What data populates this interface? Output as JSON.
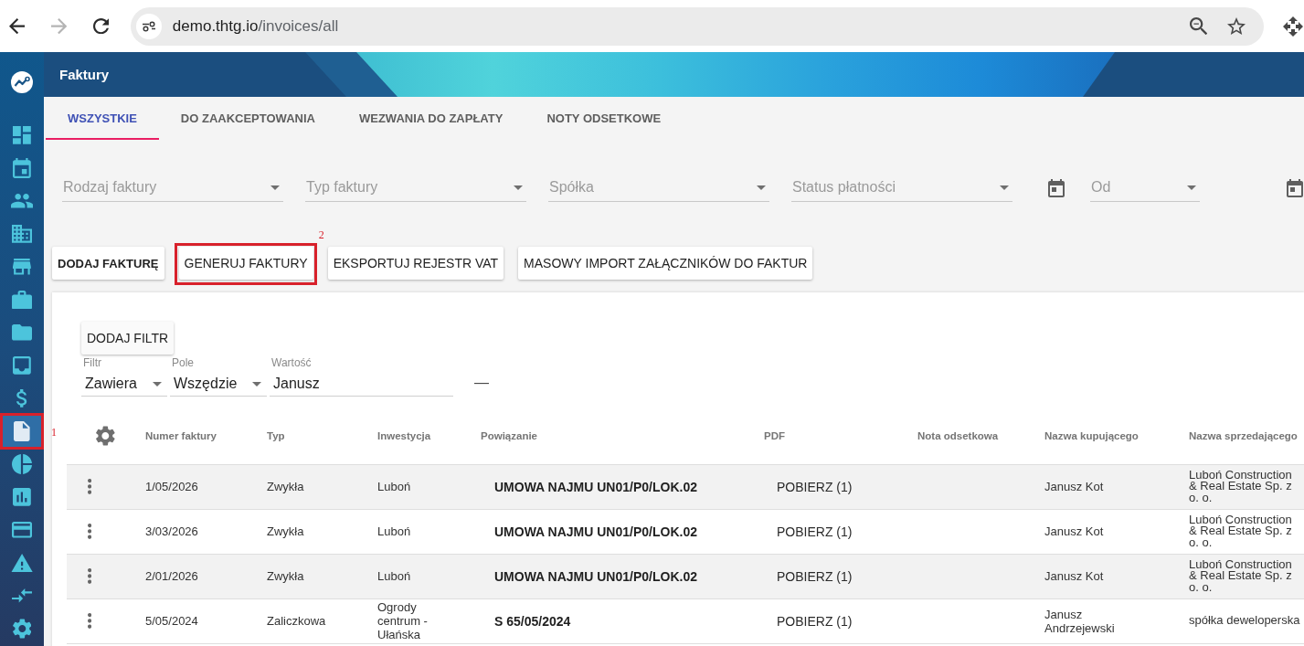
{
  "browser": {
    "url_host": "demo.thtg.io",
    "url_path": "/invoices/all",
    "forward_disabled": true
  },
  "sidebar": {
    "items": [
      {
        "kind": "dashboard",
        "selected": false
      },
      {
        "kind": "calendar",
        "selected": false
      },
      {
        "kind": "people",
        "selected": false
      },
      {
        "kind": "building",
        "selected": false
      },
      {
        "kind": "store",
        "selected": false
      },
      {
        "kind": "briefcase",
        "selected": false
      },
      {
        "kind": "folder",
        "selected": false
      },
      {
        "kind": "inbox",
        "selected": false
      },
      {
        "kind": "dollar",
        "selected": false
      },
      {
        "kind": "document",
        "selected": true,
        "annotation": "1"
      },
      {
        "kind": "pie-chart",
        "selected": false
      },
      {
        "kind": "bar-chart",
        "selected": false
      },
      {
        "kind": "credit-card",
        "selected": false
      },
      {
        "kind": "warning",
        "selected": false
      },
      {
        "kind": "arrows",
        "selected": false
      },
      {
        "kind": "settings",
        "selected": false
      }
    ]
  },
  "header": {
    "title": "Faktury"
  },
  "tabs": [
    {
      "label": "WSZYSTKIE",
      "selected": true
    },
    {
      "label": "DO ZAAKCEPTOWANIA",
      "selected": false
    },
    {
      "label": "WEZWANIA DO ZAPŁATY",
      "selected": false
    },
    {
      "label": "NOTY ODSETKOWE",
      "selected": false
    }
  ],
  "filters": [
    {
      "kind": "select",
      "placeholder": "Rodzaj faktury"
    },
    {
      "kind": "select",
      "placeholder": "Typ faktury"
    },
    {
      "kind": "select",
      "placeholder": "Spółka"
    },
    {
      "kind": "select",
      "placeholder": "Status płatności"
    },
    {
      "kind": "date",
      "placeholder": "Od"
    },
    {
      "kind": "date"
    }
  ],
  "actions": [
    {
      "label": "DODAJ FAKTURĘ",
      "emphasized": true
    },
    {
      "label": "GENERUJ FAKTURY",
      "emphasized": false,
      "annotation": "2"
    },
    {
      "label": "EKSPORTUJ REJESTR VAT",
      "emphasized": false
    },
    {
      "label": "MASOWY IMPORT ZAŁĄCZNIKÓW DO FAKTUR",
      "emphasized": false
    }
  ],
  "filter_panel": {
    "add_button": "DODAJ FILTR",
    "rules": [
      {
        "operator": {
          "label": "Filtr",
          "value": "Zawiera"
        },
        "field": {
          "label": "Pole",
          "value": "Wszędzie"
        },
        "value": {
          "label": "Wartość",
          "value": "Janusz"
        },
        "remove": "—"
      }
    ]
  },
  "table": {
    "columns": [
      "Numer faktury",
      "Typ",
      "Inwestycja",
      "Powiązanie",
      "PDF",
      "Nota odsetkowa",
      "Nazwa kupującego",
      "Nazwa sprzedającego"
    ],
    "rows": [
      {
        "number": "1/05/2026",
        "type": "Zwykła",
        "investment": "Luboń",
        "relation": "UMOWA NAJMU UN01/P0/LOK.02",
        "pdf": "POBIERZ (1)",
        "buyer": "Janusz Kot",
        "seller": "Luboń Construction & Real Estate Sp. z o. o."
      },
      {
        "number": "3/03/2026",
        "type": "Zwykła",
        "investment": "Luboń",
        "relation": "UMOWA NAJMU UN01/P0/LOK.02",
        "pdf": "POBIERZ (1)",
        "buyer": "Janusz Kot",
        "seller": "Luboń Construction & Real Estate Sp. z o. o."
      },
      {
        "number": "2/01/2026",
        "type": "Zwykła",
        "investment": "Luboń",
        "relation": "UMOWA NAJMU UN01/P0/LOK.02",
        "pdf": "POBIERZ (1)",
        "buyer": "Janusz Kot",
        "seller": "Luboń Construction & Real Estate Sp. z o. o."
      },
      {
        "number": "5/05/2024",
        "type": "Zaliczkowa",
        "investment": "Ogrody centrum - Ułańska",
        "relation": "S 65/05/2024",
        "pdf": "POBIERZ (1)",
        "buyer": "Janusz Andrzejewski",
        "seller": "spółka deweloperska"
      }
    ]
  }
}
